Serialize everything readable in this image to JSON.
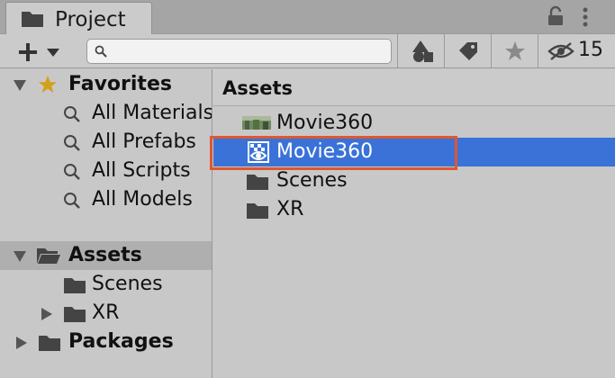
{
  "tab": {
    "title": "Project",
    "icon": "folder-icon"
  },
  "window_controls": {
    "lock_icon": "lock-icon",
    "menu_icon": "kebab-menu-icon"
  },
  "toolbar": {
    "create_icon": "plus-icon",
    "dropdown_icon": "caret-down-icon",
    "search": {
      "value": "",
      "placeholder": ""
    },
    "buttons": [
      "filter-by-type-icon",
      "filter-by-label-icon",
      "favorites-star-icon",
      "hidden-packages-icon"
    ],
    "hidden_packages_count": "15"
  },
  "tree": {
    "favorites": {
      "label": "Favorites",
      "items": [
        "All Materials",
        "All Prefabs",
        "All Scripts",
        "All Models"
      ]
    },
    "assets": {
      "label": "Assets",
      "children": [
        "Scenes",
        "XR"
      ]
    },
    "packages": {
      "label": "Packages"
    }
  },
  "assets_view": {
    "title": "Assets",
    "items": [
      {
        "label": "Movie360",
        "icon": "video-thumbnail-icon",
        "selected": false
      },
      {
        "label": "Movie360",
        "icon": "video-player-icon",
        "selected": true
      },
      {
        "label": "Scenes",
        "icon": "folder-icon",
        "selected": false
      },
      {
        "label": "XR",
        "icon": "folder-icon",
        "selected": false
      }
    ]
  },
  "colors": {
    "selection": "#3a72d8",
    "highlight_border": "#e0572f",
    "panel_bg": "#c8c8c8",
    "tree_selected": "#afafaf",
    "star": "#d4a017"
  }
}
